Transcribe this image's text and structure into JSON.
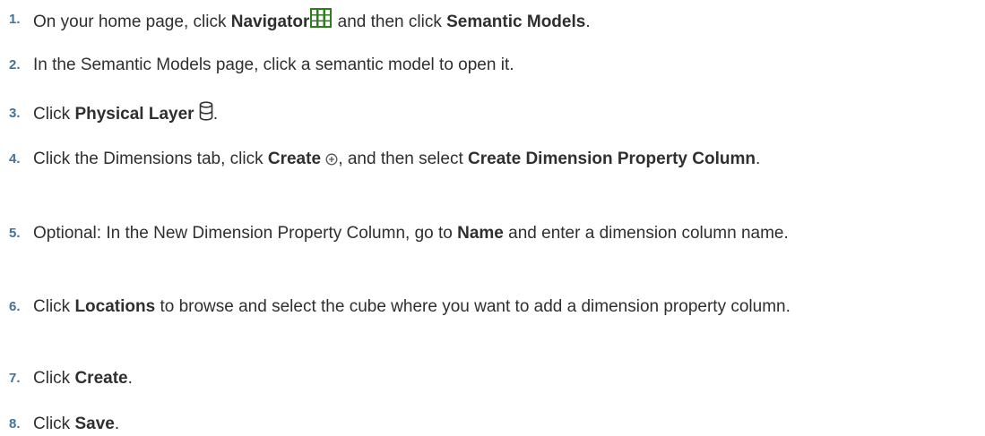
{
  "steps": [
    {
      "number": "1.",
      "t1": "On your home page, click ",
      "b1": "Navigator",
      "icon": "navigator-grid-icon",
      "t2": " and then click ",
      "b2": "Semantic Models",
      "t3": "."
    },
    {
      "number": "2.",
      "t1": "In the Semantic Models page, click a semantic model to open it."
    },
    {
      "number": "3.",
      "t1": "Click ",
      "b1": "Physical Layer",
      "icon": "database-icon",
      "t2": "."
    },
    {
      "number": "4.",
      "t1": "Click the Dimensions tab, click ",
      "b1": "Create",
      "icon": "add-circle-icon",
      "t2": ", and then select ",
      "b2": "Create Dimension Property Column",
      "t3": "."
    },
    {
      "number": "5.",
      "t1": "Optional: In the New Dimension Property Column, go to ",
      "b1": "Name",
      "t2": " and enter a dimension column name."
    },
    {
      "number": "6.",
      "t1": "Click ",
      "b1": "Locations",
      "t2": " to browse and select the cube where you want to add a dimension property column."
    },
    {
      "number": "7.",
      "t1": "Click ",
      "b1": "Create",
      "t2": "."
    },
    {
      "number": "8.",
      "t1": "Click ",
      "b1": "Save",
      "t2": "."
    }
  ],
  "colors": {
    "step_number": "#41739b",
    "body_text": "#2f2f2f",
    "navigator_icon": "#2e7d1f"
  }
}
